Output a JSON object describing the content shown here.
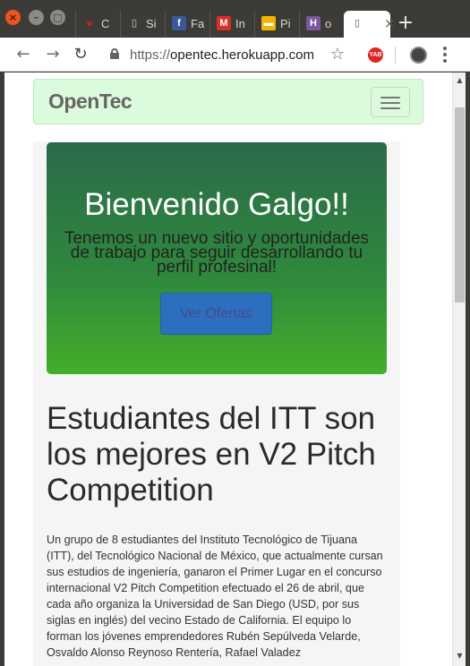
{
  "tabs": [
    {
      "icon": "vivaaerobus-icon",
      "icon_glyph": "ν",
      "icon_color": "#e0231f",
      "label": "C"
    },
    {
      "icon": "blank-page-icon",
      "icon_glyph": "▯",
      "icon_color": "#9a9893",
      "label": "Si"
    },
    {
      "icon": "facebook-icon",
      "icon_glyph": "f",
      "icon_color": "#3b5998",
      "label": "Fa"
    },
    {
      "icon": "gmail-icon",
      "icon_glyph": "M",
      "icon_color": "#d93025",
      "label": "In"
    },
    {
      "icon": "google-slides-icon",
      "icon_glyph": "▬",
      "icon_color": "#f4b400",
      "label": "Pi"
    },
    {
      "icon": "heroku-icon",
      "icon_glyph": "H",
      "icon_color": "#79589f",
      "label": "o"
    }
  ],
  "active_tab": {
    "icon": "blank-page-icon",
    "close": "×"
  },
  "new_tab": "+",
  "toolbar": {
    "back": "←",
    "forward": "→",
    "reload": "↻",
    "url_scheme": "https://",
    "url_host": "opentec.herokuapp.com",
    "star": "☆",
    "extension_label": "YAB"
  },
  "navbar": {
    "brand": "OpenTec"
  },
  "hero": {
    "title": "Bienvenido Galgo!!",
    "subtitle": "Tenemos un nuevo sitio y oportunidades de trabajo para seguir desarrollando tu perfil profesinal!",
    "button": "Ver Ofertas"
  },
  "article": {
    "headline": "Estudiantes del ITT son los mejores en V2 Pitch Competition",
    "body": "Un grupo de 8 estudiantes del Instituto Tecnológico de Tijuana (ITT), del Tecnológico Nacional de México, que actualmente cursan sus estudios de ingeniería, ganaron el Primer Lugar en el concurso internacional V2 Pitch Competition efectuado el 26 de abril, que cada año organiza la Universidad de San Diego (USD, por sus siglas en inglés) del vecino Estado de California. El equipo lo forman los jóvenes emprendedores Rubén Sepúlveda Velarde, Osvaldo Alonso Reynoso Rentería, Rafael Valadez"
  },
  "colors": {
    "navbar_bg": "#dcfadc",
    "hero_top": "#2b6a49",
    "hero_bottom": "#44ae2c",
    "button_bg": "#2c6fbf"
  }
}
